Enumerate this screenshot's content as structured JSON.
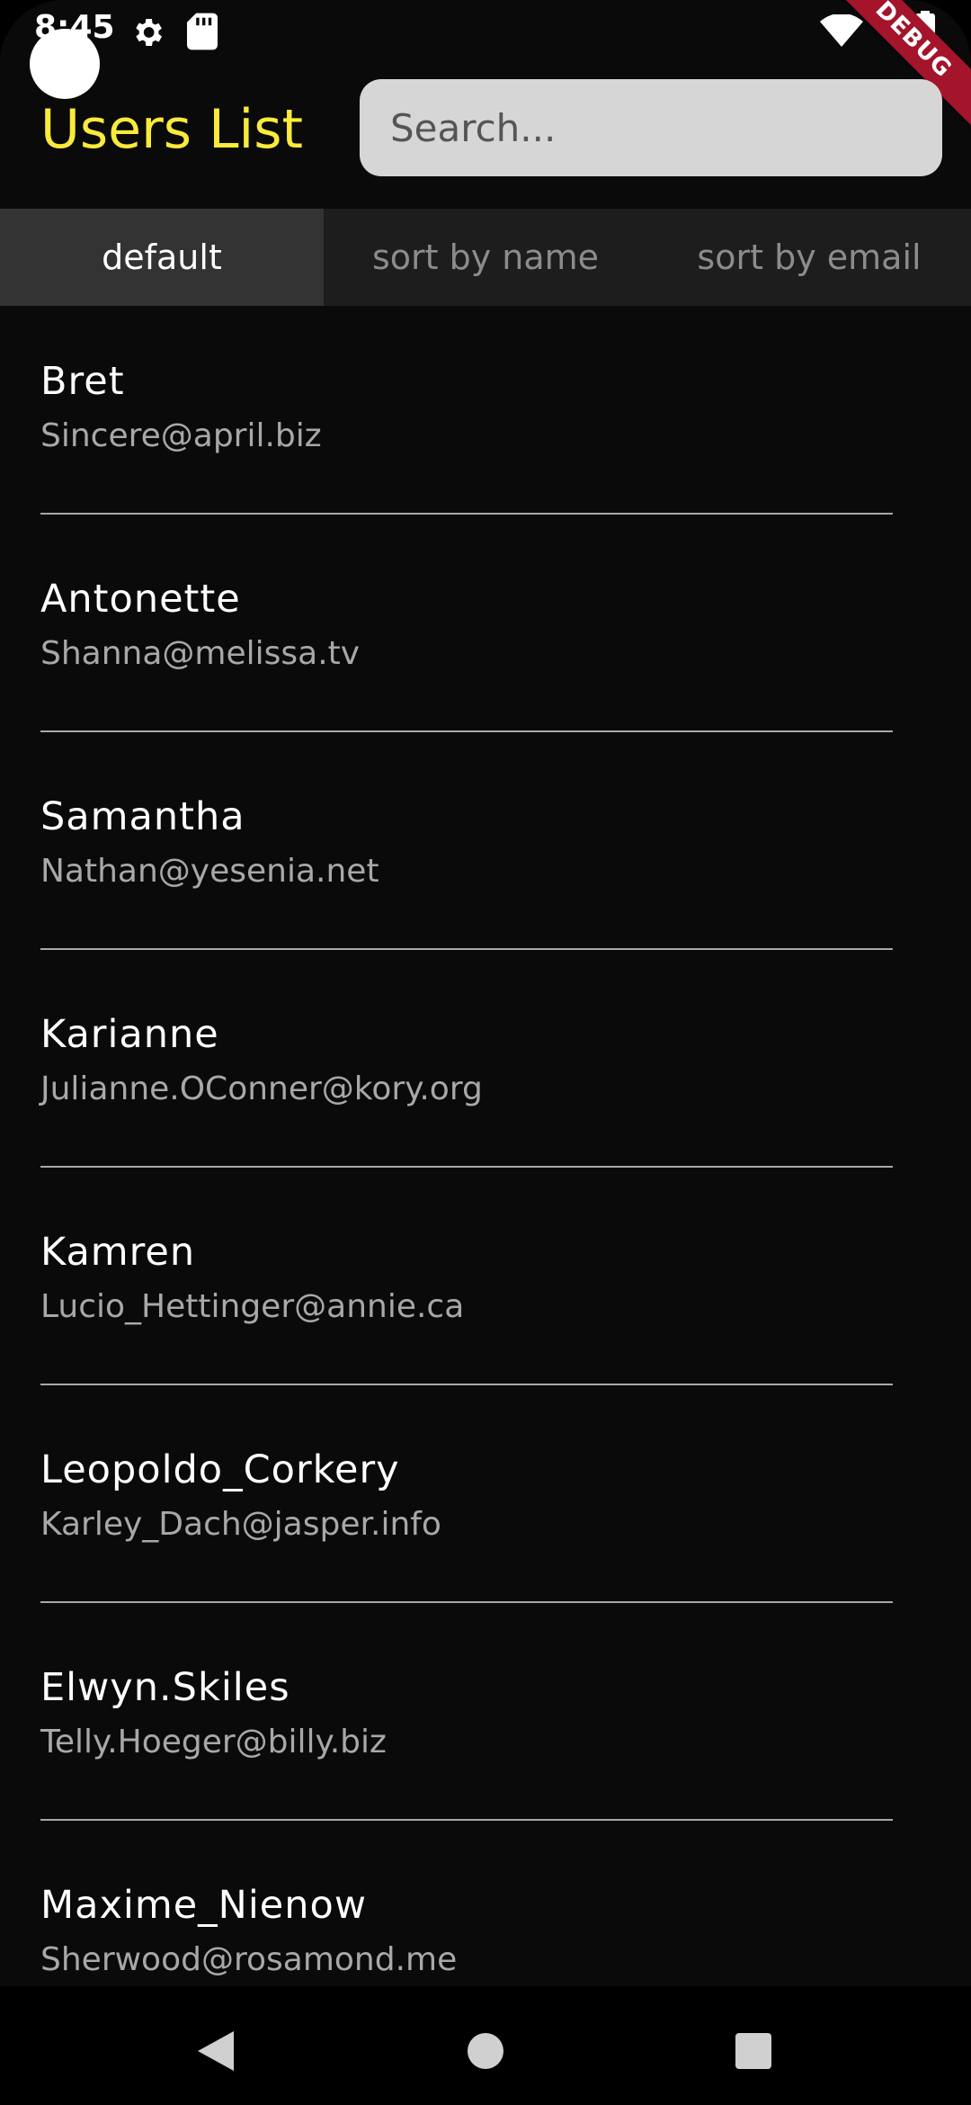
{
  "status_bar": {
    "time": "8:45",
    "icons": [
      "gear-icon",
      "sd-card-icon",
      "wifi-icon",
      "battery-icon"
    ]
  },
  "debug_banner": "DEBUG",
  "app_bar": {
    "title": "Users List",
    "title_color": "#f9ea3b",
    "search_placeholder": "Search..."
  },
  "tabs": [
    {
      "label": "default",
      "active": true
    },
    {
      "label": "sort by name",
      "active": false
    },
    {
      "label": "sort by email",
      "active": false
    }
  ],
  "users": [
    {
      "name": "Bret",
      "email": "Sincere@april.biz"
    },
    {
      "name": "Antonette",
      "email": "Shanna@melissa.tv"
    },
    {
      "name": "Samantha",
      "email": "Nathan@yesenia.net"
    },
    {
      "name": "Karianne",
      "email": "Julianne.OConner@kory.org"
    },
    {
      "name": "Kamren",
      "email": "Lucio_Hettinger@annie.ca"
    },
    {
      "name": "Leopoldo_Corkery",
      "email": "Karley_Dach@jasper.info"
    },
    {
      "name": "Elwyn.Skiles",
      "email": "Telly.Hoeger@billy.biz"
    },
    {
      "name": "Maxime_Nienow",
      "email": "Sherwood@rosamond.me"
    }
  ],
  "nav_bar": {
    "icons": [
      "back-icon",
      "home-icon",
      "recents-icon"
    ]
  }
}
